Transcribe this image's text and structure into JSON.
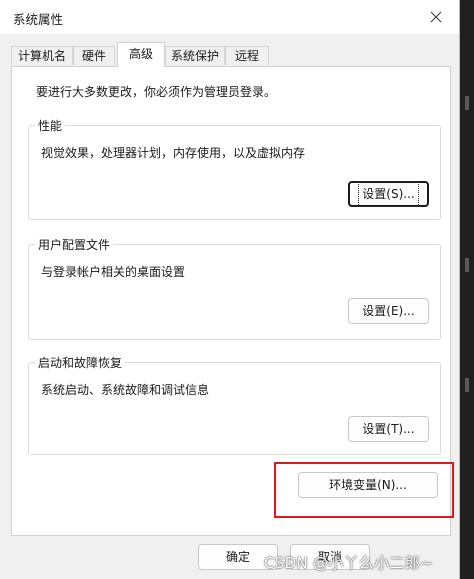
{
  "window": {
    "title": "系统属性"
  },
  "tabs": [
    {
      "label": "计算机名",
      "active": false
    },
    {
      "label": "硬件",
      "active": false
    },
    {
      "label": "高级",
      "active": true
    },
    {
      "label": "系统保护",
      "active": false
    },
    {
      "label": "远程",
      "active": false
    }
  ],
  "notice": "要进行大多数更改，你必须作为管理员登录。",
  "groups": {
    "performance": {
      "title": "性能",
      "description": "视觉效果，处理器计划，内存使用，以及虚拟内存",
      "button": "设置(S)..."
    },
    "user_profiles": {
      "title": "用户配置文件",
      "description": "与登录帐户相关的桌面设置",
      "button": "设置(E)..."
    },
    "startup_recovery": {
      "title": "启动和故障恢复",
      "description": "系统启动、系统故障和调试信息",
      "button": "设置(T)..."
    }
  },
  "env_button": "环境变量(N)...",
  "footer": {
    "ok": "确定",
    "cancel": "取消"
  },
  "watermark": "CSDN @小丫么小二郎~",
  "colors": {
    "highlight_border": "#e0181b",
    "panel_bg": "#ffffff",
    "window_bg": "#f0f0f0"
  }
}
